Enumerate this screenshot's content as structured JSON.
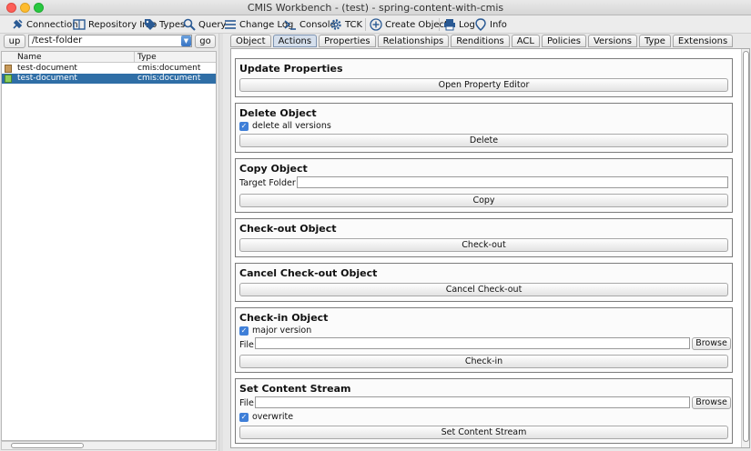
{
  "window": {
    "title": "CMIS Workbench - (test) - spring-content-with-cmis"
  },
  "toolbar": {
    "connection": "Connection",
    "repository_info": "Repository Info",
    "types": "Types",
    "query": "Query",
    "change_log": "Change Log",
    "console": "Console",
    "tck": "TCK",
    "create_object": "Create Object",
    "log": "Log",
    "info": "Info"
  },
  "navigator": {
    "up_label": "up",
    "path": "/test-folder",
    "go_label": "go",
    "columns": [
      "Name",
      "Type"
    ],
    "rows": [
      {
        "name": "test-document",
        "type": "cmis:document"
      },
      {
        "name": "test-document",
        "type": "cmis:document"
      }
    ]
  },
  "tabs": [
    "Object",
    "Actions",
    "Properties",
    "Relationships",
    "Renditions",
    "ACL",
    "Policies",
    "Versions",
    "Type",
    "Extensions"
  ],
  "active_tab": "Actions",
  "actions": {
    "update_properties": {
      "title": "Update Properties",
      "button": "Open Property Editor"
    },
    "delete_object": {
      "title": "Delete Object",
      "checkbox": "delete all versions",
      "button": "Delete"
    },
    "copy_object": {
      "title": "Copy Object",
      "field_label": "Target Folder Id:",
      "field_value": "",
      "button": "Copy"
    },
    "checkout": {
      "title": "Check-out Object",
      "button": "Check-out"
    },
    "cancel_checkout": {
      "title": "Cancel Check-out Object",
      "button": "Cancel Check-out"
    },
    "checkin": {
      "title": "Check-in Object",
      "checkbox": "major version",
      "file_label": "File:",
      "file_value": "",
      "browse": "Browse",
      "button": "Check-in"
    },
    "set_content": {
      "title": "Set Content Stream",
      "file_label": "File:",
      "file_value": "",
      "browse": "Browse",
      "checkbox": "overwrite",
      "button": "Set Content Stream"
    }
  }
}
